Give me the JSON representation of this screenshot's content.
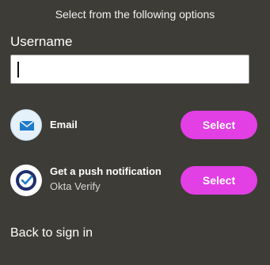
{
  "header": {
    "title": "Select from the following options"
  },
  "username": {
    "label": "Username",
    "value": "",
    "placeholder": ""
  },
  "options": [
    {
      "title": "Email",
      "subtitle": "",
      "icon": "email-icon",
      "button_label": "Select"
    },
    {
      "title": "Get a push notification",
      "subtitle": "Okta Verify",
      "icon": "okta-verify-icon",
      "button_label": "Select"
    }
  ],
  "footer": {
    "back_link": "Back to sign in"
  },
  "colors": {
    "background": "#3e3c37",
    "select_button": "#e23fe5",
    "email_icon_bg": "#e4f1fb",
    "email_icon_glyph": "#1f7ac7",
    "okta_icon_ring": "#1f2f6b"
  }
}
